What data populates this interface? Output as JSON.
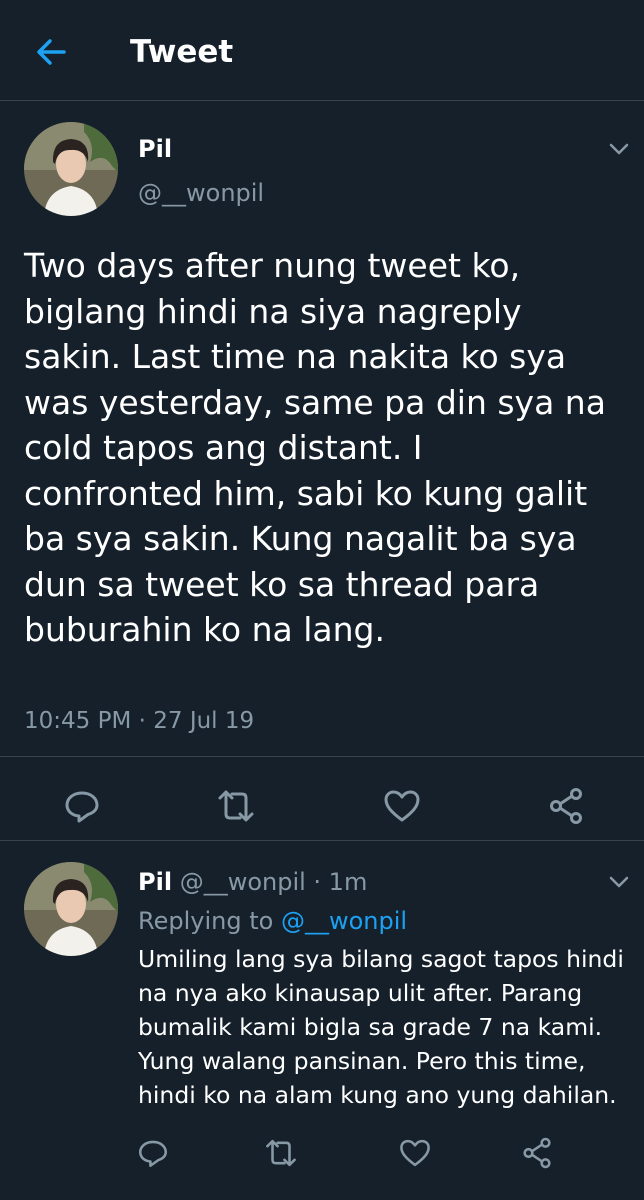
{
  "header": {
    "title": "Tweet"
  },
  "main_tweet": {
    "name": "Pil",
    "handle": "@__wonpil",
    "text_lines": [
      "Two days after nung tweet ko,",
      "biglang hindi na siya nagreply",
      "sakin. Last time na nakita ko sya",
      "was yesterday, same pa din sya na",
      "cold tapos ang distant. I",
      "confronted him, sabi ko kung galit",
      "ba sya sakin. Kung nagalit ba sya",
      "dun sa tweet ko sa thread para",
      "buburahin ko na lang."
    ],
    "timestamp": "10:45 PM · 27 Jul 19"
  },
  "reply_tweet": {
    "name": "Pil",
    "handle_time": "@__wonpil · 1m",
    "replying_prefix": "Replying to ",
    "replying_handle": "@__wonpil",
    "text_lines": [
      "Umiling lang sya bilang sagot tapos hindi",
      "na nya ako kinausap ulit after. Parang",
      "bumalik kami bigla sa grade 7 na kami.",
      "Yung walang pansinan. Pero this time,",
      "hindi ko na alam kung ano yung dahilan."
    ]
  },
  "colors": {
    "background": "#15202b",
    "accent": "#1da1f2",
    "secondary_text": "#8899a6",
    "divider": "#38444d"
  },
  "icons": [
    "back-arrow-icon",
    "chevron-down-icon",
    "reply-icon",
    "retweet-icon",
    "like-icon",
    "share-icon"
  ]
}
